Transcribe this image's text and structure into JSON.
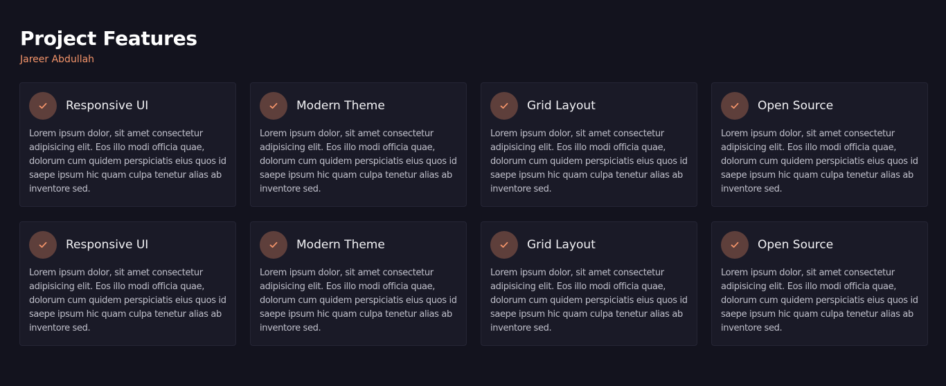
{
  "header": {
    "title": "Project Features",
    "author": "Jareer Abdullah"
  },
  "colors": {
    "background": "#13131e",
    "card": "#1a1a27",
    "accent": "#f4946a",
    "badge": "#5e3f3b"
  },
  "cards": [
    {
      "title": "Responsive UI",
      "icon": "check-icon",
      "description": "Lorem ipsum dolor, sit amet consectetur adipisicing elit. Eos illo modi officia quae, dolorum cum quidem perspiciatis eius quos id saepe ipsum hic quam culpa tenetur alias ab inventore sed."
    },
    {
      "title": "Modern Theme",
      "icon": "check-icon",
      "description": "Lorem ipsum dolor, sit amet consectetur adipisicing elit. Eos illo modi officia quae, dolorum cum quidem perspiciatis eius quos id saepe ipsum hic quam culpa tenetur alias ab inventore sed."
    },
    {
      "title": "Grid Layout",
      "icon": "check-icon",
      "description": "Lorem ipsum dolor, sit amet consectetur adipisicing elit. Eos illo modi officia quae, dolorum cum quidem perspiciatis eius quos id saepe ipsum hic quam culpa tenetur alias ab inventore sed."
    },
    {
      "title": "Open Source",
      "icon": "check-icon",
      "description": "Lorem ipsum dolor, sit amet consectetur adipisicing elit. Eos illo modi officia quae, dolorum cum quidem perspiciatis eius quos id saepe ipsum hic quam culpa tenetur alias ab inventore sed."
    },
    {
      "title": "Responsive UI",
      "icon": "check-icon",
      "description": "Lorem ipsum dolor, sit amet consectetur adipisicing elit. Eos illo modi officia quae, dolorum cum quidem perspiciatis eius quos id saepe ipsum hic quam culpa tenetur alias ab inventore sed."
    },
    {
      "title": "Modern Theme",
      "icon": "check-icon",
      "description": "Lorem ipsum dolor, sit amet consectetur adipisicing elit. Eos illo modi officia quae, dolorum cum quidem perspiciatis eius quos id saepe ipsum hic quam culpa tenetur alias ab inventore sed."
    },
    {
      "title": "Grid Layout",
      "icon": "check-icon",
      "description": "Lorem ipsum dolor, sit amet consectetur adipisicing elit. Eos illo modi officia quae, dolorum cum quidem perspiciatis eius quos id saepe ipsum hic quam culpa tenetur alias ab inventore sed."
    },
    {
      "title": "Open Source",
      "icon": "check-icon",
      "description": "Lorem ipsum dolor, sit amet consectetur adipisicing elit. Eos illo modi officia quae, dolorum cum quidem perspiciatis eius quos id saepe ipsum hic quam culpa tenetur alias ab inventore sed."
    }
  ]
}
